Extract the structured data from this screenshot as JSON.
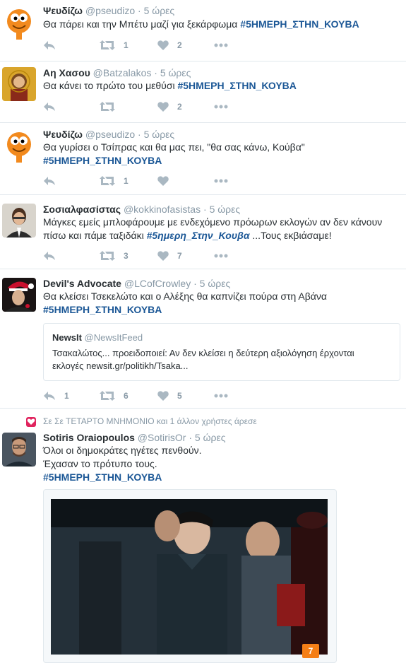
{
  "tweets": [
    {
      "name": "Ψευδίζω",
      "handle": "@pseudizo",
      "time": "5 ώρες",
      "text": "Θα πάρει και την Μπέτυ μαζί για ξεκάρφωμα",
      "hashtag": "#5ΗΜΕΡΗ_ΣΤΗΝ_ΚΟΥΒΑ",
      "retweets": "1",
      "likes": "2"
    },
    {
      "name": "Αη Χασου",
      "handle": "@Batzalakos",
      "time": "5 ώρες",
      "text": "Θα κάνει το πρώτο του μεθύσι",
      "hashtag": "#5ΗΜΕΡΗ_ΣΤΗΝ_ΚΟΥΒΑ",
      "retweets": "",
      "likes": "2"
    },
    {
      "name": "Ψευδίζω",
      "handle": "@pseudizo",
      "time": "5 ώρες",
      "text": "Θα γυρίσει ο Τσίπρας και θα μας πει, \"θα σας κάνω, Κούβα\"",
      "hashtag": "#5ΗΜΕΡΗ_ΣΤΗΝ_ΚΟΥΒΑ",
      "retweets": "1",
      "likes": ""
    },
    {
      "name": "Σοσιαλφασίστας",
      "handle": "@kokkinofasistas",
      "time": "5 ώρες",
      "text_line1": "Μάγκες εμείς μπλοφάρουμε με ενδεχόμενο πρόωρων εκλογών αν δεν κάνουν",
      "text_line2_pre": "πίσω και πάμε ταξιδάκι",
      "hashtag": "#5ημερη_Στην_Κουβα",
      "text_line2_post": "...Τους εκβιάσαμε!",
      "retweets": "3",
      "likes": "7"
    },
    {
      "name": "Devil's Advocate",
      "handle": "@LCofCrowley",
      "time": "5 ώρες",
      "text": "Θα κλείσει Τσεκελώτο και ο Αλέξης θα καπνίζει πούρα στη Αβάνα",
      "hashtag": "#5ΗΜΕΡΗ_ΣΤΗΝ_ΚΟΥΒΑ",
      "quote": {
        "name": "NewsIt",
        "handle": "@NewsItFeed",
        "line1": "Τσακαλώτος... προειδοποιεί: Αν δεν κλείσει η δεύτερη αξιολόγηση έρχονται",
        "line2": "εκλογές newsit.gr/politikh/Tsaka..."
      },
      "replies": "1",
      "retweets": "6",
      "likes": "5"
    },
    {
      "context": "Σε Σε ΤΕΤΑΡΤΟ ΜΝΗΜΟΝΙΟ και 1 άλλον χρήστες άρεσε",
      "name": "Sotiris Oraiopoulos",
      "handle": "@SotirisOr",
      "time": "5 ώρες",
      "line1": "Όλοι οι δημοκράτες ηγέτες πενθούν.",
      "line2": "Έχασαν το πρότυπο τους.",
      "hashtag": "#5ΗΜΕΡΗ_ΣΤΗΝ_ΚΟΥΒΑ",
      "media_badge": "7"
    }
  ],
  "icons": {
    "reply": "reply-icon",
    "retweet": "retweet-icon",
    "like": "heart-icon",
    "more": "more-icon"
  },
  "colors": {
    "hashtag": "#1b5796",
    "meta": "#8899a6",
    "icon": "#aab8c2",
    "like_badge": "#e0245e",
    "media_badge": "#f57f17"
  },
  "separator": "·"
}
